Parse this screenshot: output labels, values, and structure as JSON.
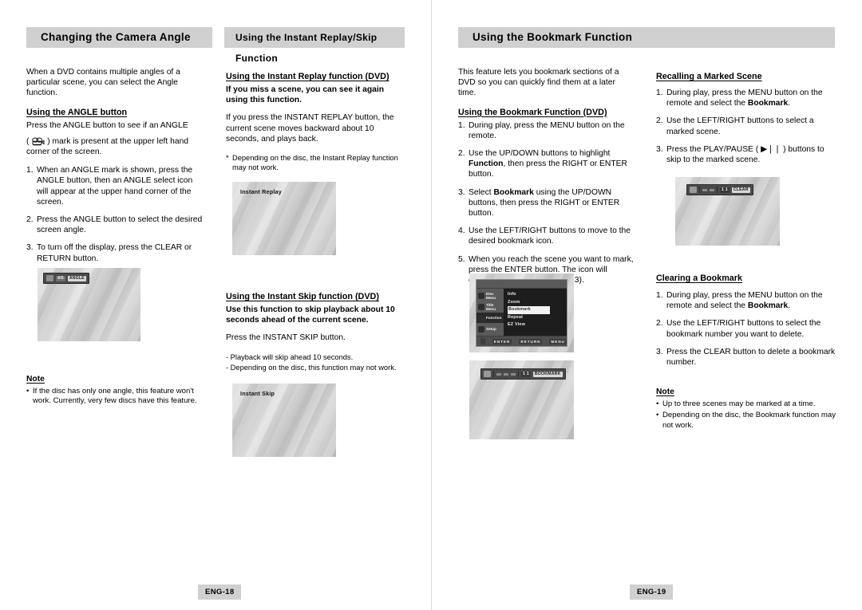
{
  "left_page": {
    "page_number": "ENG-18",
    "col1": {
      "header": "Changing the Camera Angle",
      "intro": "When a DVD contains multiple angles of a particular scene, you can select the Angle function.",
      "sub1": "Using the ANGLE button",
      "line1": "Press the ANGLE button to see if an ANGLE",
      "line2_pre": "(",
      "line2_post": ") mark is present at the upper left hand corner of the screen.",
      "steps": [
        {
          "num": "1.",
          "text": "When an ANGLE mark is shown, press the ANGLE button, then an ANGLE select icon will appear at the upper hand corner of the screen."
        },
        {
          "num": "2.",
          "text": "Press the ANGLE button to select the desired screen angle."
        },
        {
          "num": "3.",
          "text": "To turn off the display, press the CLEAR or RETURN button."
        }
      ],
      "screenshot": {
        "name": "angle-osd-screenshot",
        "osd_icon": "camera-angle-icon",
        "osd_count": "4/6",
        "osd_label": "ANGLE"
      },
      "note_title": "Note",
      "notes": [
        "If the disc has only one angle, this feature won't work. Currently, very few discs have this feature."
      ]
    },
    "col2": {
      "header": "Using the Instant Replay/Skip Function",
      "sub1": "Using the Instant Replay function (DVD)",
      "lead1": "If you miss a scene, you can see it again using this function.",
      "para1": "If you press the INSTANT REPLAY button, the current scene moves backward about 10 seconds, and plays back.",
      "star1": "Depending on the disc, the Instant Replay function may not work.",
      "shot1_label": "Instant Replay",
      "sub2": "Using the Instant Skip function (DVD)",
      "lead2": "Use this function to skip playback about 10 seconds ahead of the current scene.",
      "para2": "Press the INSTANT SKIP button.",
      "dashes": [
        "- Playback will skip ahead 10 seconds.",
        "- Depending on the disc, this function may not work."
      ],
      "shot2_label": "Instant Skip"
    }
  },
  "right_page": {
    "page_number": "ENG-19",
    "header": "Using the Bookmark Function",
    "col1": {
      "intro": "This feature lets you bookmark sections of a DVD so you can quickly find them at a later time.",
      "sub1": "Using the Bookmark Function (DVD)",
      "steps": [
        {
          "num": "1.",
          "parts": [
            {
              "t": "During play, press the MENU button on the remote."
            }
          ]
        },
        {
          "num": "2.",
          "parts": [
            {
              "t": "Use the UP/DOWN buttons to highlight "
            },
            {
              "t": "Function",
              "b": true
            },
            {
              "t": ", then press the RIGHT or ENTER button."
            }
          ]
        },
        {
          "num": "3.",
          "parts": [
            {
              "t": "Select "
            },
            {
              "t": "Bookmark",
              "b": true
            },
            {
              "t": " using the UP/DOWN buttons, then press the RIGHT or ENTER button."
            }
          ]
        },
        {
          "num": "4.",
          "parts": [
            {
              "t": "Use the LEFT/RIGHT buttons to move to the desired bookmark icon."
            }
          ]
        },
        {
          "num": "5.",
          "parts": [
            {
              "t": "When you reach the scene you want to mark, press the ENTER button. The icon will change to a number (1, 2, or 3)."
            }
          ]
        }
      ],
      "osd_menu": {
        "left_items": [
          "Disc Menu",
          "Title Menu",
          "Function",
          "Setup"
        ],
        "active_left_item": "Function",
        "options": [
          "Info",
          "Zoom",
          "Bookmark",
          "Repeat",
          "EZ View"
        ],
        "selected_option": "Bookmark",
        "keys": [
          "ENTER",
          "RETURN",
          "MENU"
        ]
      },
      "bookmark_shot": {
        "name": "bookmark-osd-screenshot",
        "osd_icon": "bookmark-icon",
        "osd_label": "BOOKMARK"
      }
    },
    "col2": {
      "sub1": "Recalling a Marked Scene",
      "steps1": [
        {
          "num": "1.",
          "parts": [
            {
              "t": "During play, press the MENU button on the remote and select the "
            },
            {
              "t": "Bookmark",
              "b": true
            },
            {
              "t": "."
            }
          ]
        },
        {
          "num": "2.",
          "parts": [
            {
              "t": "Use the LEFT/RIGHT buttons to select a marked scene."
            }
          ]
        },
        {
          "num": "3.",
          "parts": [
            {
              "t": "Press the PLAY/PAUSE ( ▶❘❘ ) buttons to skip to the marked scene."
            }
          ]
        }
      ],
      "recall_shot": {
        "name": "recall-osd-screenshot",
        "osd_icon": "home-icon",
        "osd_label": "CLEAR"
      },
      "sub2": "Clearing a Bookmark",
      "steps2": [
        {
          "num": "1.",
          "parts": [
            {
              "t": "During play, press the MENU button on the remote and select the "
            },
            {
              "t": "Bookmark",
              "b": true
            },
            {
              "t": "."
            }
          ]
        },
        {
          "num": "2.",
          "parts": [
            {
              "t": "Use the LEFT/RIGHT buttons to select the bookmark number you want to delete."
            }
          ]
        },
        {
          "num": "3.",
          "parts": [
            {
              "t": "Press the CLEAR button to delete a bookmark number."
            }
          ]
        }
      ],
      "note_title": "Note",
      "notes": [
        "Up to three scenes may be marked at a time.",
        "Depending on the disc, the Bookmark function may not work."
      ]
    }
  },
  "colors": {
    "header_bar": "#d0d0d0",
    "page_background": "#ffffff",
    "text": "#000000",
    "screenshot_gray": "#c9c9c9"
  }
}
